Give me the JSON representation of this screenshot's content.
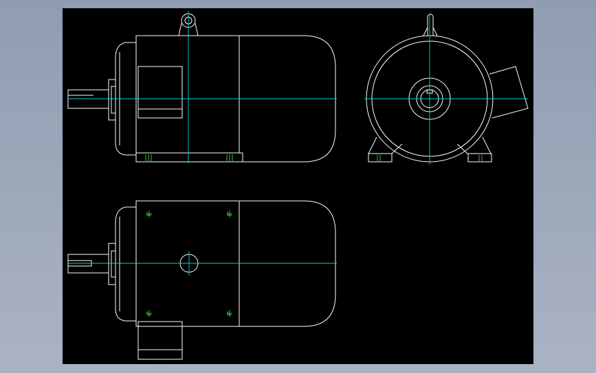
{
  "colors": {
    "background": "#000000",
    "outline": "#ffffff",
    "centerline": "#00d8d8",
    "hole_marks": "#30e030",
    "desktop": "#9aa6b8"
  },
  "views": [
    {
      "id": "front-view",
      "label": ""
    },
    {
      "id": "side-view",
      "label": ""
    },
    {
      "id": "top-view",
      "label": ""
    }
  ]
}
